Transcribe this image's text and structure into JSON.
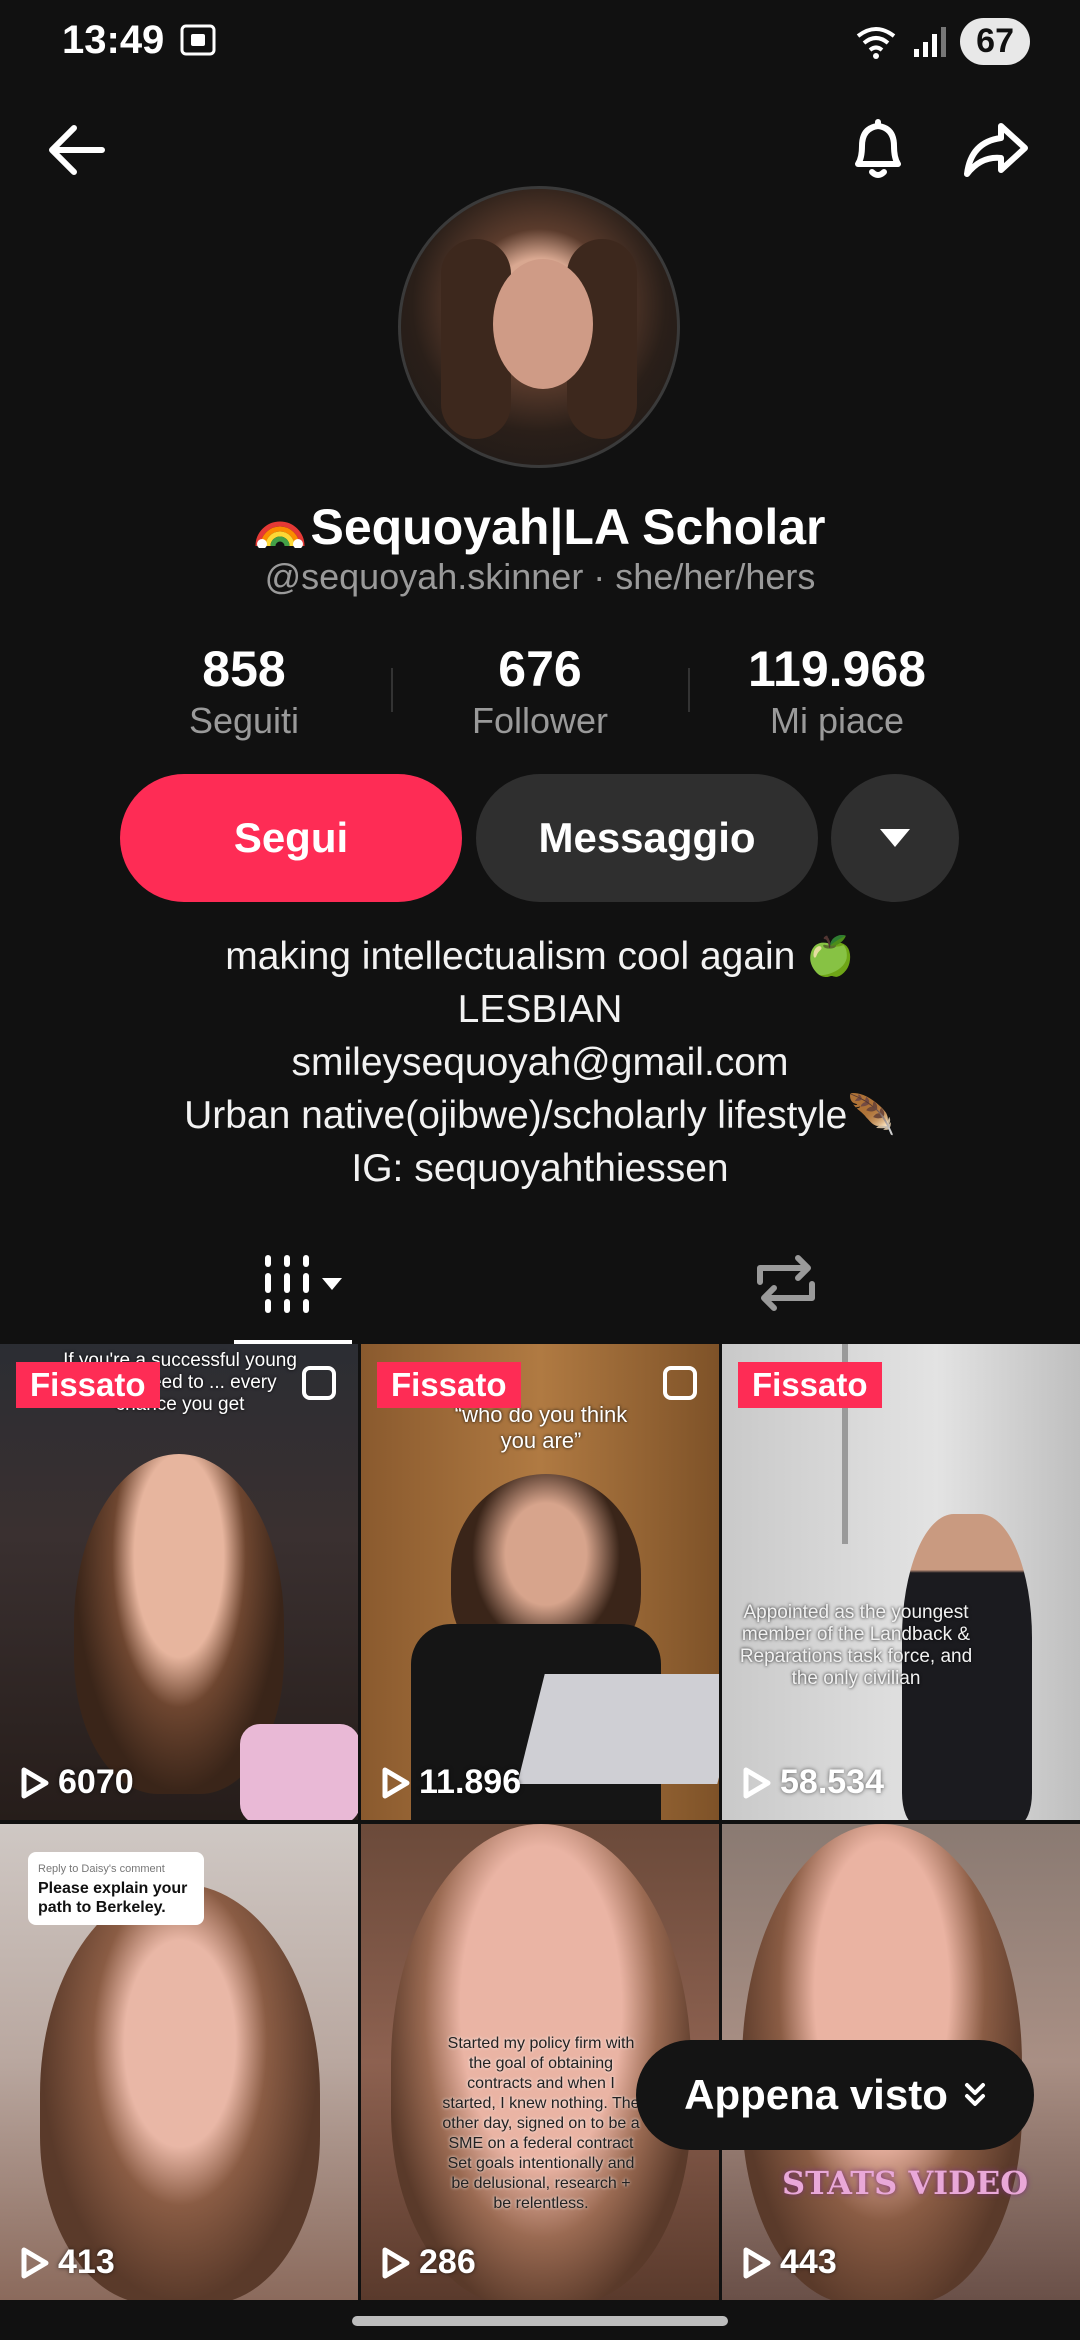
{
  "status_bar": {
    "time": "13:49",
    "battery": "67"
  },
  "profile": {
    "display_name": "Sequoyah|LA Scholar",
    "handle": "@sequoyah.skinner · she/her/hers"
  },
  "stats": [
    {
      "value": "858",
      "label": "Seguiti"
    },
    {
      "value": "676",
      "label": "Follower"
    },
    {
      "value": "119.968",
      "label": "Mi piace"
    }
  ],
  "actions": {
    "follow": "Segui",
    "message": "Messaggio"
  },
  "bio": [
    "making intellectualism cool again 🍏",
    "LESBIAN",
    "smileysequoyah@gmail.com",
    "Urban native(ojibwe)/scholarly lifestyle🪶",
    "IG: sequoyahthiessen"
  ],
  "videos": [
    {
      "pinned": "Fissato",
      "views": "6070",
      "overlay": "If you're a successful young ... you need to ... every chance you get"
    },
    {
      "pinned": "Fissato",
      "views": "11.896",
      "overlay": "“who do you think you are”"
    },
    {
      "pinned": "Fissato",
      "views": "58.534",
      "overlay": "Appointed as the youngest member of the Landback & Reparations task force, and the only civilian"
    },
    {
      "views": "413",
      "reply_small": "Reply to Daisy's comment",
      "reply": "Please explain your path to Berkeley."
    },
    {
      "views": "286",
      "overlay": "Started my policy firm with the goal of obtaining contracts and when I started, I knew nothing. The other day, signed on to be a SME on a federal contract Set goals intentionally and be delusional, research + be relentless."
    },
    {
      "views": "443",
      "overlay": "STATS VIDEO"
    }
  ],
  "toast": {
    "label": "Appena visto"
  },
  "colors": {
    "accent": "#fe2c55",
    "background": "#111111",
    "secondary_button": "#2f2f2f"
  }
}
